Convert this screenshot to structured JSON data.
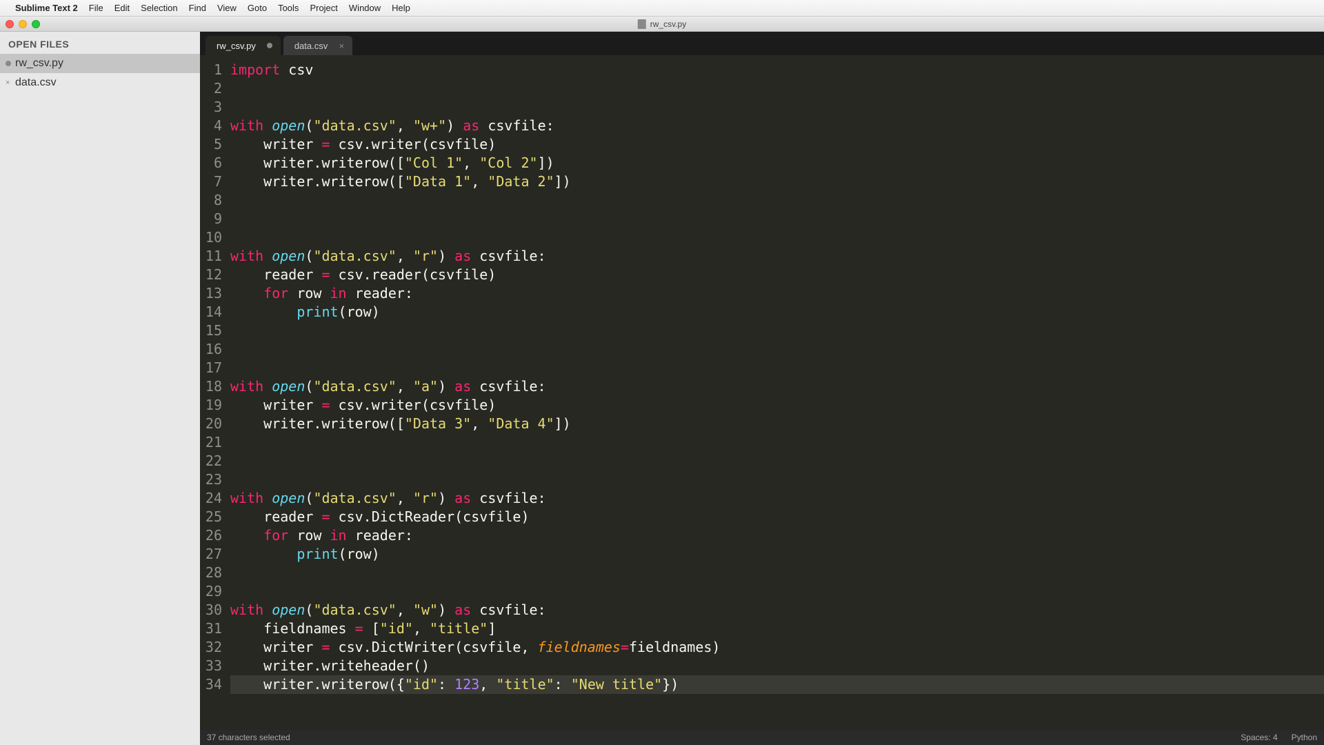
{
  "menubar": {
    "apple": "",
    "app": "Sublime Text 2",
    "items": [
      "File",
      "Edit",
      "Selection",
      "Find",
      "View",
      "Goto",
      "Tools",
      "Project",
      "Window",
      "Help"
    ]
  },
  "window": {
    "title": "rw_csv.py"
  },
  "sidebar": {
    "header": "OPEN FILES",
    "files": [
      {
        "name": "rw_csv.py",
        "active": true,
        "modified": true
      },
      {
        "name": "data.csv",
        "active": false,
        "modified": false
      }
    ]
  },
  "tabs": [
    {
      "label": "rw_csv.py",
      "active": true,
      "modified": true
    },
    {
      "label": "data.csv",
      "active": false,
      "modified": false
    }
  ],
  "code": {
    "lines": [
      {
        "n": 1,
        "tokens": [
          [
            "kw",
            "import"
          ],
          [
            "id",
            " csv"
          ]
        ]
      },
      {
        "n": 2,
        "tokens": []
      },
      {
        "n": 3,
        "tokens": []
      },
      {
        "n": 4,
        "tokens": [
          [
            "kw",
            "with"
          ],
          [
            "id",
            " "
          ],
          [
            "fn",
            "open"
          ],
          [
            "id",
            "("
          ],
          [
            "str",
            "\"data.csv\""
          ],
          [
            "id",
            ", "
          ],
          [
            "str",
            "\"w+\""
          ],
          [
            "id",
            ") "
          ],
          [
            "kw",
            "as"
          ],
          [
            "id",
            " csvfile:"
          ]
        ]
      },
      {
        "n": 5,
        "tokens": [
          [
            "id",
            "    writer "
          ],
          [
            "op",
            "="
          ],
          [
            "id",
            " csv.writer(csvfile)"
          ]
        ]
      },
      {
        "n": 6,
        "tokens": [
          [
            "id",
            "    writer.writerow(["
          ],
          [
            "str",
            "\"Col 1\""
          ],
          [
            "id",
            ", "
          ],
          [
            "str",
            "\"Col 2\""
          ],
          [
            "id",
            "])"
          ]
        ]
      },
      {
        "n": 7,
        "tokens": [
          [
            "id",
            "    writer.writerow(["
          ],
          [
            "str",
            "\"Data 1\""
          ],
          [
            "id",
            ", "
          ],
          [
            "str",
            "\"Data 2\""
          ],
          [
            "id",
            "])"
          ]
        ]
      },
      {
        "n": 8,
        "tokens": []
      },
      {
        "n": 9,
        "tokens": []
      },
      {
        "n": 10,
        "tokens": []
      },
      {
        "n": 11,
        "tokens": [
          [
            "kw",
            "with"
          ],
          [
            "id",
            " "
          ],
          [
            "fn",
            "open"
          ],
          [
            "id",
            "("
          ],
          [
            "str",
            "\"data.csv\""
          ],
          [
            "id",
            ", "
          ],
          [
            "str",
            "\"r\""
          ],
          [
            "id",
            ") "
          ],
          [
            "kw",
            "as"
          ],
          [
            "id",
            " csvfile:"
          ]
        ]
      },
      {
        "n": 12,
        "tokens": [
          [
            "id",
            "    reader "
          ],
          [
            "op",
            "="
          ],
          [
            "id",
            " csv.reader(csvfile)"
          ]
        ]
      },
      {
        "n": 13,
        "tokens": [
          [
            "id",
            "    "
          ],
          [
            "kw",
            "for"
          ],
          [
            "id",
            " row "
          ],
          [
            "kw",
            "in"
          ],
          [
            "id",
            " reader:"
          ]
        ]
      },
      {
        "n": 14,
        "tokens": [
          [
            "id",
            "        "
          ],
          [
            "builtin",
            "print"
          ],
          [
            "id",
            "(row)"
          ]
        ]
      },
      {
        "n": 15,
        "tokens": []
      },
      {
        "n": 16,
        "tokens": []
      },
      {
        "n": 17,
        "tokens": []
      },
      {
        "n": 18,
        "tokens": [
          [
            "kw",
            "with"
          ],
          [
            "id",
            " "
          ],
          [
            "fn",
            "open"
          ],
          [
            "id",
            "("
          ],
          [
            "str",
            "\"data.csv\""
          ],
          [
            "id",
            ", "
          ],
          [
            "str",
            "\"a\""
          ],
          [
            "id",
            ") "
          ],
          [
            "kw",
            "as"
          ],
          [
            "id",
            " csvfile:"
          ]
        ]
      },
      {
        "n": 19,
        "tokens": [
          [
            "id",
            "    writer "
          ],
          [
            "op",
            "="
          ],
          [
            "id",
            " csv.writer(csvfile)"
          ]
        ]
      },
      {
        "n": 20,
        "tokens": [
          [
            "id",
            "    writer.writerow(["
          ],
          [
            "str",
            "\"Data 3\""
          ],
          [
            "id",
            ", "
          ],
          [
            "str",
            "\"Data 4\""
          ],
          [
            "id",
            "])"
          ]
        ]
      },
      {
        "n": 21,
        "tokens": []
      },
      {
        "n": 22,
        "tokens": []
      },
      {
        "n": 23,
        "tokens": []
      },
      {
        "n": 24,
        "tokens": [
          [
            "kw",
            "with"
          ],
          [
            "id",
            " "
          ],
          [
            "fn",
            "open"
          ],
          [
            "id",
            "("
          ],
          [
            "str",
            "\"data.csv\""
          ],
          [
            "id",
            ", "
          ],
          [
            "str",
            "\"r\""
          ],
          [
            "id",
            ") "
          ],
          [
            "kw",
            "as"
          ],
          [
            "id",
            " csvfile:"
          ]
        ]
      },
      {
        "n": 25,
        "tokens": [
          [
            "id",
            "    reader "
          ],
          [
            "op",
            "="
          ],
          [
            "id",
            " csv.DictReader(csvfile)"
          ]
        ]
      },
      {
        "n": 26,
        "tokens": [
          [
            "id",
            "    "
          ],
          [
            "kw",
            "for"
          ],
          [
            "id",
            " row "
          ],
          [
            "kw",
            "in"
          ],
          [
            "id",
            " reader:"
          ]
        ]
      },
      {
        "n": 27,
        "tokens": [
          [
            "id",
            "        "
          ],
          [
            "builtin",
            "print"
          ],
          [
            "id",
            "(row)"
          ]
        ]
      },
      {
        "n": 28,
        "tokens": []
      },
      {
        "n": 29,
        "tokens": []
      },
      {
        "n": 30,
        "tokens": [
          [
            "kw",
            "with"
          ],
          [
            "id",
            " "
          ],
          [
            "fn",
            "open"
          ],
          [
            "id",
            "("
          ],
          [
            "str",
            "\"data.csv\""
          ],
          [
            "id",
            ", "
          ],
          [
            "str",
            "\"w\""
          ],
          [
            "id",
            ") "
          ],
          [
            "kw",
            "as"
          ],
          [
            "id",
            " csvfile:"
          ]
        ]
      },
      {
        "n": 31,
        "tokens": [
          [
            "id",
            "    fieldnames "
          ],
          [
            "op",
            "="
          ],
          [
            "id",
            " ["
          ],
          [
            "str",
            "\"id\""
          ],
          [
            "id",
            ", "
          ],
          [
            "str",
            "\"title\""
          ],
          [
            "id",
            "]"
          ]
        ]
      },
      {
        "n": 32,
        "tokens": [
          [
            "id",
            "    writer "
          ],
          [
            "op",
            "="
          ],
          [
            "id",
            " csv.DictWriter(csvfile, "
          ],
          [
            "arg",
            "fieldnames"
          ],
          [
            "op",
            "="
          ],
          [
            "id",
            "fieldnames)"
          ]
        ]
      },
      {
        "n": 33,
        "tokens": [
          [
            "id",
            "    writer.writeheader()"
          ]
        ]
      },
      {
        "n": 34,
        "tokens": [
          [
            "id",
            "    writer.writerow({"
          ],
          [
            "str",
            "\"id\""
          ],
          [
            "id",
            ": "
          ],
          [
            "num",
            "123"
          ],
          [
            "id",
            ", "
          ],
          [
            "str",
            "\"title\""
          ],
          [
            "id",
            ": "
          ],
          [
            "str",
            "\"New title\""
          ],
          [
            "id",
            "})"
          ]
        ],
        "selected": true
      }
    ]
  },
  "statusbar": {
    "left": "37 characters selected",
    "spaces": "Spaces: 4",
    "lang": "Python"
  }
}
